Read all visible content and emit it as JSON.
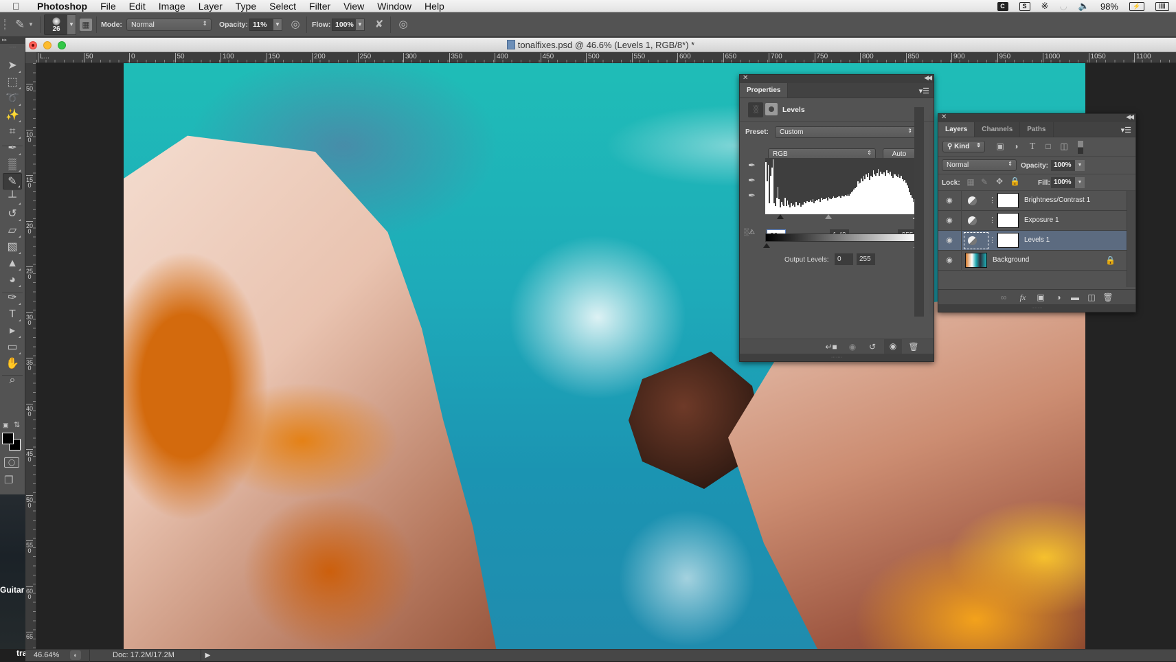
{
  "menubar": {
    "apple_icon": "apple-icon",
    "app_name": "Photoshop",
    "items": [
      "File",
      "Edit",
      "Image",
      "Layer",
      "Type",
      "Select",
      "Filter",
      "View",
      "Window",
      "Help"
    ],
    "tray": {
      "battery_percent": "98%",
      "icons": [
        "creative-cloud-icon",
        "shield-s-icon",
        "bluetooth-icon",
        "wifi-icon",
        "volume-icon",
        "battery-charging-icon",
        "battery-icon"
      ]
    }
  },
  "options_bar": {
    "tool_icon": "brush-icon",
    "brush_size": "26",
    "mode_label": "Mode:",
    "mode_value": "Normal",
    "opacity_label": "Opacity:",
    "opacity_value": "11%",
    "flow_label": "Flow:",
    "flow_value": "100%"
  },
  "tools": [
    {
      "name": "move-tool",
      "glyph": "➤"
    },
    {
      "name": "marquee-tool",
      "glyph": "⬚"
    },
    {
      "name": "lasso-tool",
      "glyph": "➰"
    },
    {
      "name": "magic-wand-tool",
      "glyph": "✨"
    },
    {
      "name": "crop-tool",
      "glyph": "⌗"
    },
    {
      "name": "eyedropper-tool",
      "glyph": "✒"
    },
    {
      "name": "spot-healing-tool",
      "glyph": "▒"
    },
    {
      "name": "brush-tool",
      "glyph": "✎",
      "active": true
    },
    {
      "name": "clone-stamp-tool",
      "glyph": "┴"
    },
    {
      "name": "history-brush-tool",
      "glyph": "↺"
    },
    {
      "name": "eraser-tool",
      "glyph": "▱"
    },
    {
      "name": "gradient-tool",
      "glyph": "▧"
    },
    {
      "name": "blur-tool",
      "glyph": "▲"
    },
    {
      "name": "dodge-tool",
      "glyph": "◕"
    },
    {
      "name": "pen-tool",
      "glyph": "✑"
    },
    {
      "name": "type-tool",
      "glyph": "T"
    },
    {
      "name": "path-selection-tool",
      "glyph": "▸"
    },
    {
      "name": "rectangle-tool",
      "glyph": "▭"
    },
    {
      "name": "hand-tool",
      "glyph": "✋"
    },
    {
      "name": "zoom-tool",
      "glyph": "⌕"
    }
  ],
  "background_text": {
    "guitar": "Guitar",
    "tra": "tra"
  },
  "document": {
    "title": "tonalfixes.psd @ 46.6% (Levels 1, RGB/8*) *",
    "file_icon_label": "Ps",
    "hruler_labels": [
      "L...",
      "50",
      "0",
      "50",
      "100",
      "150",
      "200",
      "250",
      "300",
      "350",
      "400",
      "450",
      "500",
      "550",
      "600",
      "650",
      "700",
      "750",
      "800",
      "850",
      "900",
      "950",
      "1000",
      "1050",
      "1100",
      "1"
    ],
    "vruler_labels": [
      "5 0",
      "1 0 0",
      "1 5 0",
      "2 0 0",
      "2 5 0",
      "3 0 0",
      "3 5 0",
      "4 0 0",
      "4 5 0",
      "5 0 0",
      "5 5 0",
      "6 0 0",
      "6 5"
    ],
    "status": {
      "zoom": "46.64%",
      "doc_size": "Doc: 17.2M/17.2M"
    }
  },
  "properties_panel": {
    "tab": "Properties",
    "adjustment_title": "Levels",
    "preset_label": "Preset:",
    "preset_value": "Custom",
    "channel_value": "RGB",
    "auto_button": "Auto",
    "input_black": "26",
    "input_gamma": "1.49",
    "input_white": "255",
    "input_black_fraction": 0.102,
    "input_gamma_fraction": 0.42,
    "output_label": "Output Levels:",
    "output_black": "0",
    "output_white": "255",
    "histogram": [
      95,
      60,
      90,
      20,
      70,
      85,
      100,
      20,
      15,
      30,
      50,
      28,
      12,
      22,
      18,
      15,
      30,
      15,
      25,
      18,
      13,
      20,
      15,
      17,
      14,
      22,
      16,
      16,
      20,
      14,
      18,
      17,
      22,
      20,
      24,
      22,
      23,
      25,
      22,
      27,
      20,
      24,
      26,
      25,
      28,
      23,
      30,
      26,
      27,
      28,
      30,
      25,
      31,
      29,
      28,
      30,
      32,
      30,
      30,
      31,
      33,
      32,
      30,
      34,
      33,
      32,
      35,
      34,
      36,
      34,
      38,
      40,
      42,
      45,
      48,
      50,
      60,
      55,
      58,
      65,
      60,
      70,
      64,
      72,
      68,
      75,
      62,
      70,
      68,
      80,
      72,
      70,
      75,
      82,
      70,
      78,
      74,
      72,
      76,
      70,
      80,
      75,
      72,
      78,
      70,
      66,
      74,
      72,
      70,
      68,
      72,
      66,
      70,
      64,
      60,
      62,
      58,
      52,
      48,
      40,
      35,
      30,
      22,
      28,
      45
    ]
  },
  "layers_panel": {
    "tabs": [
      "Layers",
      "Channels",
      "Paths"
    ],
    "active_tab": "Layers",
    "filter_kind": "Kind",
    "blend_mode": "Normal",
    "opacity_label": "Opacity:",
    "opacity_value": "100%",
    "lock_label": "Lock:",
    "fill_label": "Fill:",
    "fill_value": "100%",
    "layers": [
      {
        "name": "Brightness/Contrast 1",
        "type": "adjustment",
        "visible": true,
        "selected": false
      },
      {
        "name": "Exposure 1",
        "type": "adjustment",
        "visible": true,
        "selected": false
      },
      {
        "name": "Levels 1",
        "type": "adjustment",
        "visible": true,
        "selected": true
      },
      {
        "name": "Background",
        "type": "image",
        "visible": true,
        "locked": true,
        "selected": false
      }
    ]
  }
}
